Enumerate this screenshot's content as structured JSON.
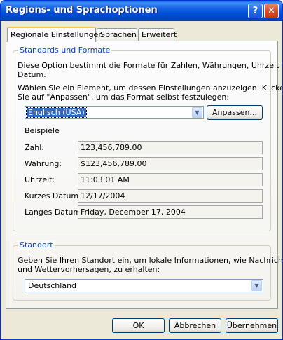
{
  "window": {
    "title": "Regions- und Sprachoptionen",
    "help_label": "?",
    "close_label": "✕"
  },
  "tabs": [
    {
      "label": "Regionale Einstellungen",
      "active": true
    },
    {
      "label": "Sprachen",
      "active": false
    },
    {
      "label": "Erweitert",
      "active": false
    }
  ],
  "standards": {
    "legend": "Standards und Formate",
    "description_line1": "Diese Option bestimmt die Formate für Zahlen, Währungen, Uhrzeit und",
    "description_line2": "Datum.",
    "instruction_line1": "Wählen Sie ein Element, um dessen Einstellungen anzuzeigen. Klicken",
    "instruction_line2": "Sie auf \"Anpassen\", um das Format selbst festzulegen:",
    "locale_selected": "Englisch (USA)",
    "customize_button": "Anpassen...",
    "examples_heading": "Beispiele",
    "examples": [
      {
        "label": "Zahl:",
        "value": "123,456,789.00"
      },
      {
        "label": "Währung:",
        "value": "$123,456,789.00"
      },
      {
        "label": "Uhrzeit:",
        "value": "11:03:01 AM"
      },
      {
        "label": "Kurzes Datum:",
        "value": "12/17/2004"
      },
      {
        "label": "Langes Datum:",
        "value": "Friday, December 17, 2004"
      }
    ]
  },
  "location": {
    "legend": "Standort",
    "description_line1": "Geben Sie Ihren Standort ein, um lokale Informationen, wie Nachrichten",
    "description_line2": "und Wettervorhersagen, zu erhalten:",
    "selected": "Deutschland"
  },
  "footer": {
    "ok_label": "OK",
    "cancel_label": "Abbrechen",
    "apply_label": "Übernehmen"
  },
  "colors": {
    "title_bar": "#0054e3",
    "group_legend": "#0046d5",
    "selection": "#316ac5",
    "close_button": "#d4502a"
  },
  "icons": {
    "help": "help-icon",
    "close": "close-icon",
    "dropdown": "chevron-down-icon"
  }
}
